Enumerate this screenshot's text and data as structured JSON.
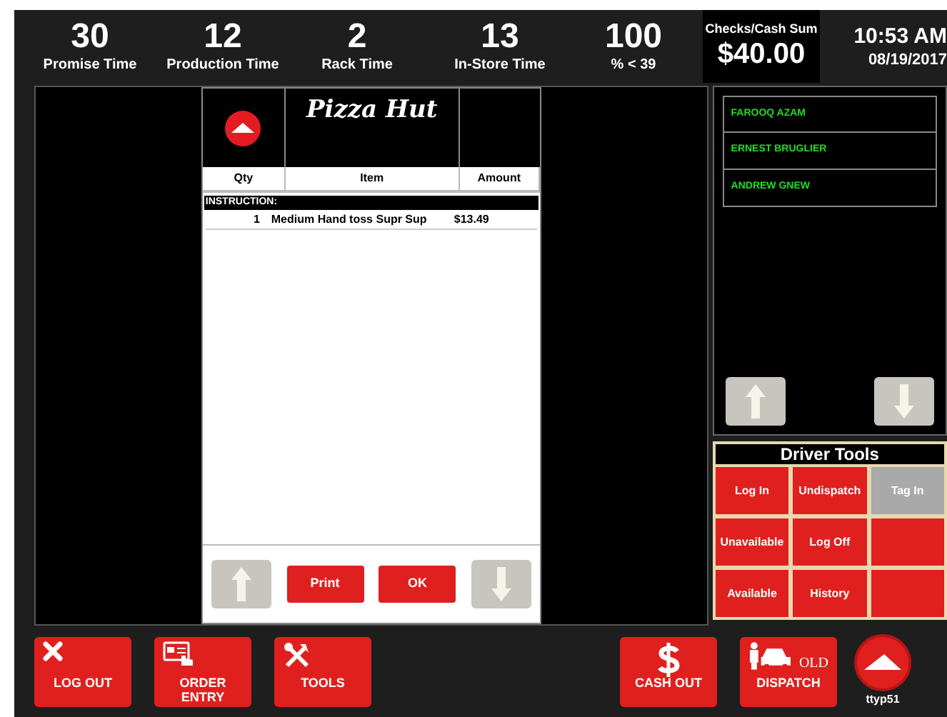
{
  "stats": [
    {
      "value": "30",
      "label": "Promise Time"
    },
    {
      "value": "12",
      "label": "Production Time"
    },
    {
      "value": "2",
      "label": "Rack Time"
    },
    {
      "value": "13",
      "label": "In-Store Time"
    },
    {
      "value": "100",
      "label": "% < 39"
    }
  ],
  "sum": {
    "label": "Checks/Cash Sum",
    "value": "$40.00"
  },
  "clock": {
    "time": "10:53 AM",
    "date": "08/19/2017"
  },
  "receipt": {
    "brand": "Pizza Hut",
    "columns": [
      "Qty",
      "Item",
      "Amount"
    ],
    "section": "INSTRUCTION:",
    "rows": [
      {
        "qty": "1",
        "item": "Medium Hand toss  Supr Sup",
        "amount": "$13.49"
      }
    ],
    "buttons": [
      {
        "kind": "up",
        "disabled": true
      },
      {
        "kind": "text",
        "label": "Print"
      },
      {
        "kind": "text",
        "label": "OK"
      },
      {
        "kind": "down",
        "disabled": true
      }
    ]
  },
  "drivers": [
    {
      "name": "FAROOQ AZAM"
    },
    {
      "name": "ERNEST BRUGLIER"
    },
    {
      "name": "ANDREW GNEW"
    }
  ],
  "driver_scroll": [
    {
      "kind": "up",
      "disabled": true
    },
    {
      "kind": "down",
      "disabled": true
    }
  ],
  "driver_tools": {
    "title": "Driver Tools",
    "buttons": [
      {
        "label": "Log In",
        "disabled": false
      },
      {
        "label": "Undispatch",
        "disabled": false
      },
      {
        "label": "Tag In",
        "disabled": true
      },
      {
        "label": "Unavailable",
        "disabled": false
      },
      {
        "label": "Log Off",
        "disabled": false
      },
      {
        "disabled": false
      },
      {
        "label": "Available",
        "disabled": false
      },
      {
        "label": "History",
        "disabled": false
      },
      {
        "disabled": false
      }
    ]
  },
  "bottom_buttons": [
    {
      "kind": "close",
      "label": "LOG OUT"
    },
    {
      "kind": "card",
      "label": "ORDER ENTRY"
    },
    {
      "kind": "tools",
      "label": "TOOLS"
    },
    {
      "kind": "dollar",
      "label": "CASH OUT"
    },
    {
      "kind": "driver",
      "tag": "OLD",
      "label": "DISPATCH"
    }
  ],
  "terminal": {
    "name": "ttyp51"
  }
}
